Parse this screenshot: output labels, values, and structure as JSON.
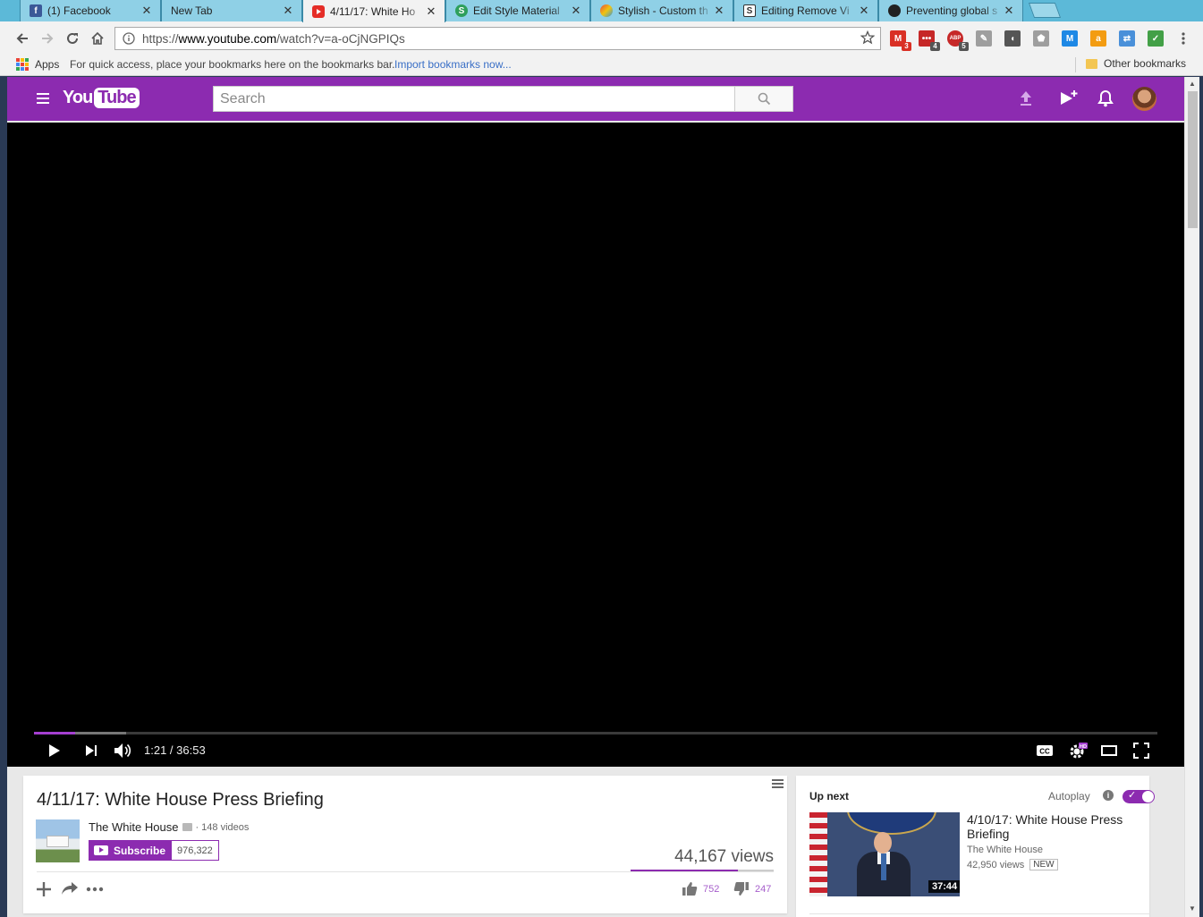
{
  "browser": {
    "tabs": [
      {
        "title": "(1) Facebook",
        "icon": "facebook-icon",
        "active": false
      },
      {
        "title": "New Tab",
        "icon": "",
        "active": false
      },
      {
        "title": "4/11/17: White Ho",
        "icon": "youtube-icon",
        "active": true
      },
      {
        "title": "Edit Style Material",
        "icon": "stylish-s-icon",
        "active": false
      },
      {
        "title": "Stylish - Custom th",
        "icon": "stylish-icon",
        "active": false
      },
      {
        "title": "Editing Remove Vi",
        "icon": "stylish-s-icon",
        "active": false
      },
      {
        "title": "Preventing global s",
        "icon": "github-icon",
        "active": false
      }
    ],
    "tab_close_glyph": "✕",
    "url_prefix": "https://",
    "url_host": "www.youtube.com",
    "url_path": "/watch?v=a-oCjNGPIQs",
    "extensions": [
      {
        "name": "gmail-extension-icon",
        "badge": "3",
        "color": "#d93025"
      },
      {
        "name": "todo-extension-icon",
        "badge": "4",
        "color": "#c62828"
      },
      {
        "name": "adblock-extension-icon",
        "badge": "5",
        "color": "#c62828"
      },
      {
        "name": "puzzle-extension-icon",
        "badge": "",
        "color": "#9e9e9e"
      },
      {
        "name": "audio-extension-icon",
        "badge": "",
        "color": "#555555"
      },
      {
        "name": "shield-extension-icon",
        "badge": "",
        "color": "#9e9e9e"
      },
      {
        "name": "m-extension-icon",
        "badge": "",
        "color": "#1e88e5"
      },
      {
        "name": "amazon-extension-icon",
        "badge": "",
        "color": "#f39c12"
      },
      {
        "name": "translate-extension-icon",
        "badge": "",
        "color": "#4a90d9"
      },
      {
        "name": "evernote-extension-icon",
        "badge": "",
        "color": "#43a047"
      }
    ]
  },
  "bookmarks": {
    "apps_label": "Apps",
    "hint": "For quick access, place your bookmarks here on the bookmarks bar.",
    "import_link": "Import bookmarks now...",
    "other": "Other bookmarks"
  },
  "youtube": {
    "accent_color": "#8c2bb0",
    "logo_you": "You",
    "logo_tube": "Tube",
    "search_placeholder": "Search",
    "player": {
      "current_time": "1:21",
      "duration": "36:53",
      "time_display": "1:21 / 36:53",
      "played_fraction": 0.037,
      "buffered_fraction": 0.082
    },
    "video": {
      "title": "4/11/17: White House Press Briefing",
      "channel": "The White House",
      "video_count": "· 148 videos",
      "subscribe_label": "Subscribe",
      "subscriber_count": "976,322",
      "views": "44,167 views",
      "likes": "752",
      "dislikes": "247",
      "like_fraction": 0.753
    },
    "sidebar": {
      "up_next_label": "Up next",
      "autoplay_label": "Autoplay",
      "autoplay_on": true,
      "next_video": {
        "title": "4/10/17: White House Press Briefing",
        "channel": "The White House",
        "views": "42,950 views",
        "badge": "NEW",
        "duration": "37:44"
      }
    }
  }
}
